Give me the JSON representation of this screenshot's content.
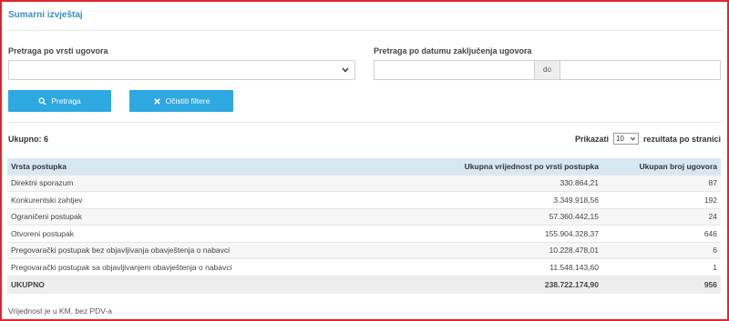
{
  "title": "Sumarni izvještaj",
  "filters": {
    "type_label": "Pretraga po vrsti ugovora",
    "type_value": "",
    "date_label": "Pretraga po datumu zaključenja ugovora",
    "date_from": "",
    "date_sep": "do",
    "date_to": ""
  },
  "buttons": {
    "search": "Pretraga",
    "clear": "Očistiti filtere"
  },
  "summary": {
    "total_label": "Ukupno: 6",
    "show_label": "Prikazati",
    "page_size": "10",
    "per_page_label": "rezultata po stranici"
  },
  "table": {
    "headers": [
      "Vrsta postupka",
      "Ukupna vrijednost po vrsti postupka",
      "Ukupan broj ugovora"
    ],
    "rows": [
      [
        "Direktni sporazum",
        "330.864,21",
        "87"
      ],
      [
        "Konkurentski zahtjev",
        "3.349.918,56",
        "192"
      ],
      [
        "Ograničeni postupak",
        "57.360.442,15",
        "24"
      ],
      [
        "Otvoreni postupak",
        "155.904.328,37",
        "646"
      ],
      [
        "Pregovarački postupak bez objavljivanja obavještenja o nabavci",
        "10.228.478,01",
        "6"
      ],
      [
        "Pregovarački postupak sa objavljivanjem obavještenja o nabavci",
        "11.548.143,60",
        "1"
      ]
    ],
    "footer": [
      "UKUPNO",
      "238.722.174,90",
      "956"
    ]
  },
  "note": "Vrijednost je u KM, bez PDV-a",
  "colors": {
    "accent": "#2ea8e0",
    "title": "#3a8fc4",
    "header_bg": "#d7e8f3",
    "frame": "#e0262a"
  },
  "icons": {
    "search": "search-icon",
    "clear": "close-icon",
    "dropdown": "chevron-down-icon"
  }
}
